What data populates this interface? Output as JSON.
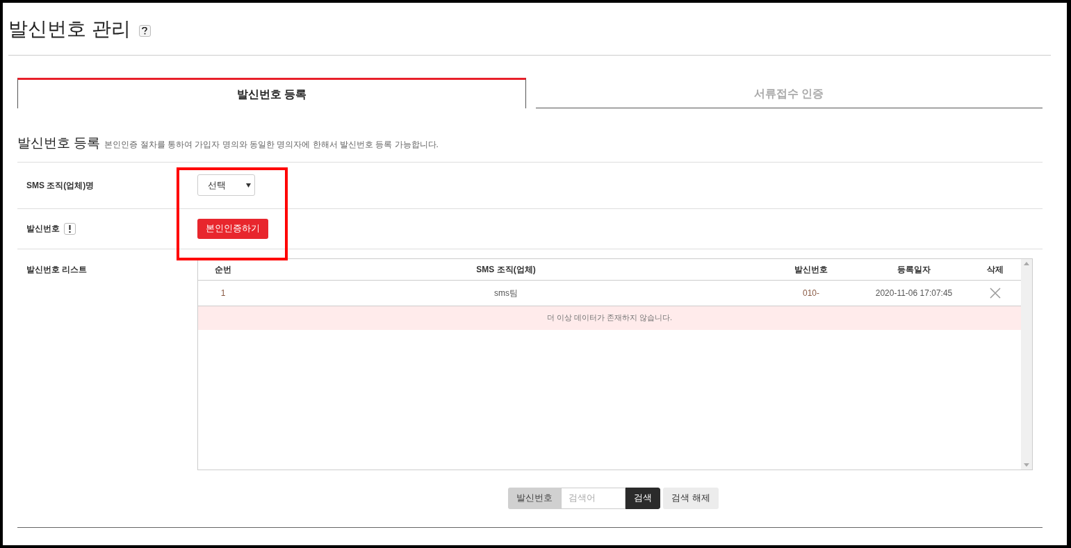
{
  "page_title": "발신번호 관리",
  "tabs": [
    {
      "label": "발신번호 등록",
      "selected": true
    },
    {
      "label": "서류접수 인증",
      "selected": false
    }
  ],
  "section": {
    "heading": "발신번호 등록",
    "description": "본인인증 절차를 통하여 가입자 명의와 동일한 명의자에 한해서 발신번호 등록 가능합니다."
  },
  "form_rows": [
    {
      "kind": "select",
      "label": "SMS 조직(업체)명",
      "value": "선택"
    },
    {
      "kind": "button",
      "label": "발신번호",
      "button": "본인인증하기"
    },
    {
      "kind": "table",
      "label": "발신번호 리스트"
    }
  ],
  "table": {
    "columns": [
      "순번",
      "SMS 조직(업체)",
      "발신번호",
      "등록일자",
      "삭제"
    ],
    "rows": [
      {
        "seq": "1",
        "org": "sms팀",
        "number": "010-",
        "date": "2020-11-06 17:07:45"
      }
    ],
    "empty_message": "더 이상 데이터가 존재하지 않습니다."
  },
  "search": {
    "field_label": "발신번호",
    "placeholder": "검색어",
    "search_button": "검색",
    "reset_button": "검색 해제"
  }
}
